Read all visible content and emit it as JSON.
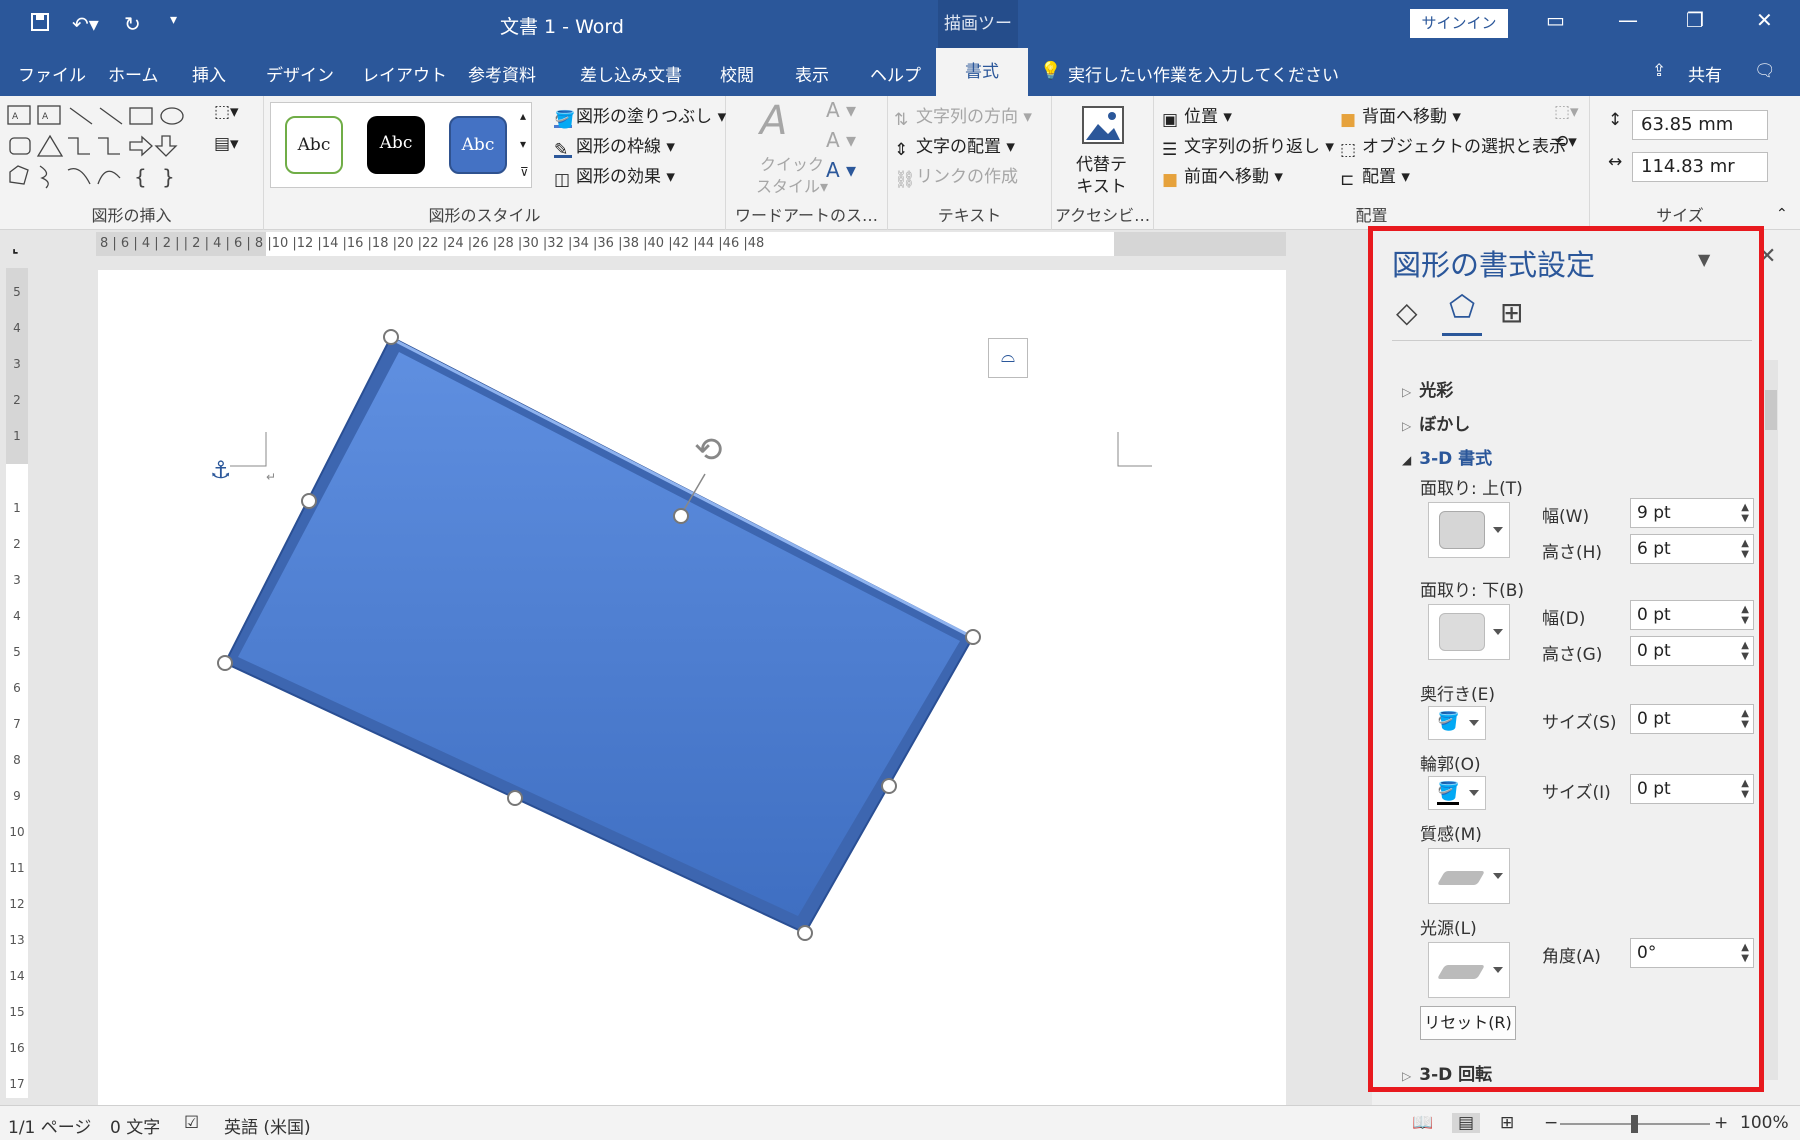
{
  "window": {
    "doc_title": "文書 1 - Word",
    "contextual_group": "描画ツール",
    "signin": "サインイン"
  },
  "tabs": [
    "ファイル",
    "ホーム",
    "挿入",
    "デザイン",
    "レイアウト",
    "参考資料",
    "差し込み文書",
    "校閲",
    "表示",
    "ヘルプ",
    "書式"
  ],
  "tell_me": "実行したい作業を入力してください",
  "share": "共有",
  "ribbon": {
    "insert_shapes": {
      "label": "図形の挿入"
    },
    "shape_styles": {
      "label": "図形の スタイル",
      "label_text": "図形のスタイル",
      "style_sample": "Abc",
      "fill": "図形の塗りつぶし",
      "outline": "図形の枠線",
      "effects": "図形の効果"
    },
    "wordart": {
      "label": "ワードアートのス…",
      "quick_line1": "クイック",
      "quick_line2": "スタイル",
      "a_glyph": "A"
    },
    "text": {
      "label": "テキスト",
      "direction": "文字列の方向",
      "align": "文字の配置",
      "link": "リンクの作成"
    },
    "accessibility": {
      "label": "アクセシビ…",
      "alt_line1": "代替テ",
      "alt_line2": "キスト"
    },
    "arrange": {
      "label": "配置",
      "position": "位置",
      "wrap": "文字列の折り返し",
      "forward": "前面へ移動",
      "backward": "背面へ移動",
      "select": "オブジェクトの選択と表示",
      "align": "配置"
    },
    "size": {
      "label": "サイズ",
      "height": "63.85 mm",
      "width": "114.83 mr"
    }
  },
  "ruler": {
    "h_ticks": "8 | 6 | 4 | 2 |  | 2 | 4 | 6 | 8 |10 |12 |14 |16 |18 |20 |22 |24 |26 |28 |30 |32 |34 |36 |38 |40 |42 |44 |46 |48",
    "v_ticks": [
      "5",
      "4",
      "3",
      "2",
      "1",
      "",
      "1",
      "2",
      "3",
      "4",
      "5",
      "6",
      "7",
      "8",
      "9",
      "10",
      "11",
      "12",
      "13",
      "14",
      "15",
      "16",
      "17"
    ]
  },
  "panel": {
    "title": "図形の書式設定",
    "sections": {
      "glow": "光彩",
      "blur": "ぼかし",
      "format3d": "3-D 書式",
      "rotation3d": "3-D 回転"
    },
    "bevel_top": {
      "label": "面取り: 上(T)",
      "width_label": "幅(W)",
      "width": "9 pt",
      "height_label": "高さ(H)",
      "height": "6 pt"
    },
    "bevel_bottom": {
      "label": "面取り: 下(B)",
      "width_label": "幅(D)",
      "width": "0 pt",
      "height_label": "高さ(G)",
      "height": "0 pt"
    },
    "depth": {
      "label": "奥行き(E)",
      "size_label": "サイズ(S)",
      "size": "0 pt"
    },
    "contour": {
      "label": "輪郭(O)",
      "size_label": "サイズ(I)",
      "size": "0 pt"
    },
    "material": {
      "label": "質感(M)"
    },
    "lighting": {
      "label": "光源(L)",
      "angle_label": "角度(A)",
      "angle": "0°"
    },
    "reset": "リセット(R)"
  },
  "status": {
    "page": "1/1 ページ",
    "words": "0 文字",
    "language": "英語 (米国)",
    "zoom": "100%"
  },
  "colors": {
    "accent": "#2b579a",
    "shape": "#4a7bd0",
    "highlight": "#e8191e"
  },
  "icons": [
    "save-icon",
    "undo-icon",
    "redo-icon",
    "anchor-icon",
    "rotate-handle-icon",
    "layout-options-icon",
    "fill-line-icon",
    "effects-icon",
    "layout-properties-icon"
  ]
}
